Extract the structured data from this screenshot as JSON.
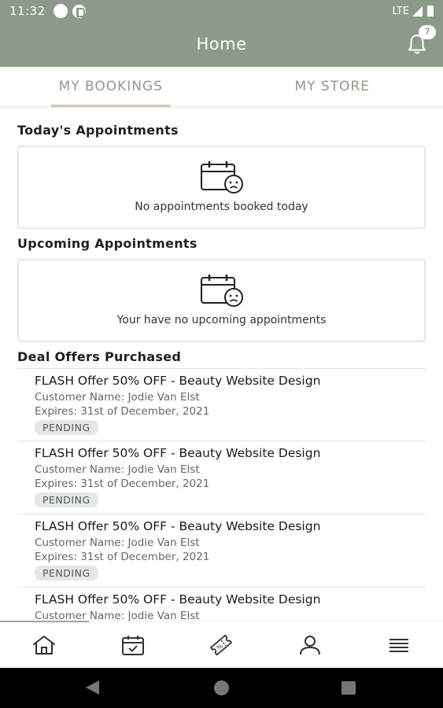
{
  "status_bar": {
    "time": "11:32",
    "network": "LTE"
  },
  "header": {
    "title": "Home",
    "notification_count": "7"
  },
  "tabs": [
    {
      "label": "MY BOOKINGS",
      "active": true
    },
    {
      "label": "MY STORE",
      "active": false
    }
  ],
  "today": {
    "title": "Today's Appointments",
    "empty_message": "No appointments booked today"
  },
  "upcoming": {
    "title": "Upcoming Appointments",
    "empty_message": "Your have no upcoming appointments"
  },
  "deals": {
    "title": "Deal Offers Purchased",
    "items": [
      {
        "name": "FLASH Offer 50% OFF - Beauty Website Design",
        "customer": "Customer Name: Jodie Van Elst",
        "expires": "Expires: 31st of December, 2021",
        "status": "PENDING"
      },
      {
        "name": "FLASH Offer 50% OFF - Beauty Website Design",
        "customer": "Customer Name: Jodie Van Elst",
        "expires": "Expires: 31st of December, 2021",
        "status": "PENDING"
      },
      {
        "name": "FLASH Offer 50% OFF - Beauty Website Design",
        "customer": "Customer Name: Jodie Van Elst",
        "expires": "Expires: 31st of December, 2021",
        "status": "PENDING"
      },
      {
        "name": "FLASH Offer 50% OFF - Beauty Website Design",
        "customer": "Customer Name: Jodie Van Elst"
      }
    ]
  },
  "bottom_nav": [
    {
      "icon": "home-icon",
      "active": true
    },
    {
      "icon": "calendar-icon",
      "active": false
    },
    {
      "icon": "ticket-icon",
      "active": false
    },
    {
      "icon": "person-icon",
      "active": false
    },
    {
      "icon": "menu-icon",
      "active": false
    }
  ],
  "colors": {
    "header_bg": "#8c9b89",
    "tab_text": "#8f9b8c",
    "tab_underline": "#d8c8b8",
    "pending_badge_bg": "#e3e8e5"
  }
}
